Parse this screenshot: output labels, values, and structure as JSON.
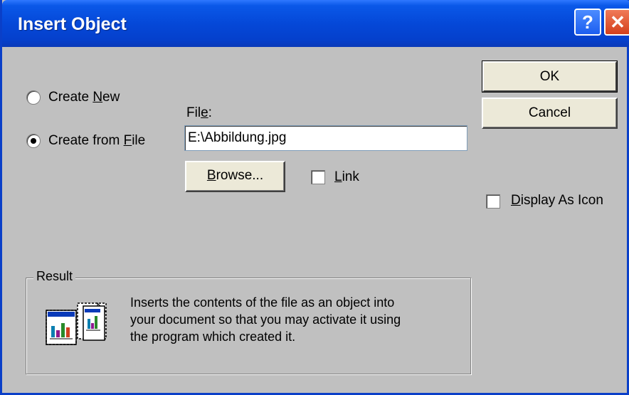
{
  "dialog": {
    "title": "Insert Object",
    "help_label": "?",
    "close_label": "✕"
  },
  "options": {
    "create_new": {
      "pre": "Create ",
      "mnemonic": "N",
      "post": "ew",
      "selected": false
    },
    "create_from_file": {
      "pre": "Create from ",
      "mnemonic": "F",
      "post": "ile",
      "selected": true
    }
  },
  "file": {
    "label_pre": "Fil",
    "label_mnemonic": "e",
    "label_post": ":",
    "value": "E:\\Abbildung.jpg"
  },
  "browse": {
    "mnemonic": "B",
    "rest": "rowse..."
  },
  "link": {
    "mnemonic": "L",
    "rest": "ink",
    "checked": false
  },
  "buttons": {
    "ok": "OK",
    "cancel": "Cancel"
  },
  "display_as_icon": {
    "mnemonic": "D",
    "rest": "isplay As Icon",
    "checked": false
  },
  "result": {
    "legend": "Result",
    "lines": [
      "Inserts the contents of the file as an object into",
      "your document so that you may activate it using",
      "the program which created it."
    ]
  },
  "colors": {
    "titlebar": "#0548d8",
    "dialog_bg": "#c0c0c0",
    "close_button": "#d4401c"
  }
}
